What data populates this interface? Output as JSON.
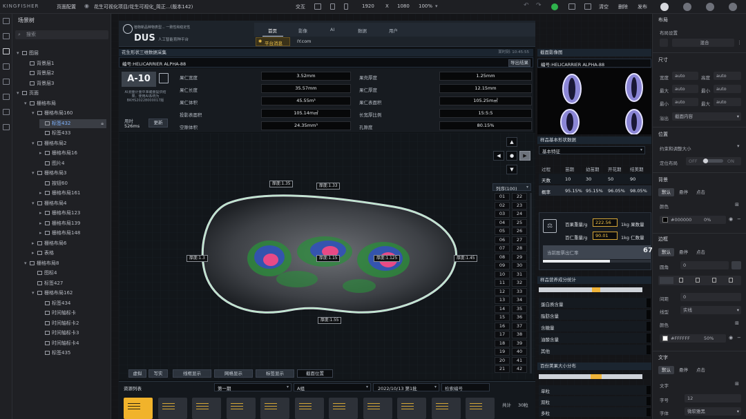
{
  "topbar": {
    "logo": "KINGFISHER",
    "menu": "页面配置",
    "breadcrumb": "花生可视化项目/花生可视化_简正...(版本142)",
    "interact": "交互",
    "width": "1920",
    "x": "X",
    "height": "1080",
    "zoom": "100%",
    "clear": "清空",
    "delete": "删除",
    "publish": "发布"
  },
  "tree": {
    "title": "场景树",
    "search_placeholder": "搜索",
    "nodes": [
      {
        "label": "图层",
        "level": 0,
        "arrow": "▾"
      },
      {
        "label": "背景层1",
        "level": 1,
        "arrow": ""
      },
      {
        "label": "背景层2",
        "level": 1,
        "arrow": ""
      },
      {
        "label": "背景层3",
        "level": 1,
        "arrow": ""
      },
      {
        "label": "页面",
        "level": 0,
        "arrow": "▾"
      },
      {
        "label": "栅格布局",
        "level": 1,
        "arrow": "▾"
      },
      {
        "label": "栅格布局160",
        "level": 2,
        "arrow": "▾"
      },
      {
        "label": "标签432",
        "level": 3,
        "arrow": "",
        "selected": true
      },
      {
        "label": "标签433",
        "level": 3,
        "arrow": ""
      },
      {
        "label": "栅格布局2",
        "level": 2,
        "arrow": "▾"
      },
      {
        "label": "栅格布局16",
        "level": 3,
        "arrow": "▸"
      },
      {
        "label": "图片4",
        "level": 3,
        "arrow": ""
      },
      {
        "label": "栅格布局3",
        "level": 2,
        "arrow": "▾"
      },
      {
        "label": "按钮60",
        "level": 3,
        "arrow": ""
      },
      {
        "label": "栅格布局161",
        "level": 3,
        "arrow": "▸"
      },
      {
        "label": "栅格布局4",
        "level": 2,
        "arrow": "▾"
      },
      {
        "label": "栅格布局123",
        "level": 3,
        "arrow": "▸"
      },
      {
        "label": "栅格布局139",
        "level": 3,
        "arrow": "▸"
      },
      {
        "label": "栅格布局148",
        "level": 3,
        "arrow": "▸"
      },
      {
        "label": "栅格布局6",
        "level": 2,
        "arrow": "▸"
      },
      {
        "label": "表格",
        "level": 2,
        "arrow": "▸"
      },
      {
        "label": "栅格布局8",
        "level": 1,
        "arrow": "▾"
      },
      {
        "label": "图标4",
        "level": 2,
        "arrow": ""
      },
      {
        "label": "标签427",
        "level": 2,
        "arrow": ""
      },
      {
        "label": "栅格布局162",
        "level": 2,
        "arrow": "▾"
      },
      {
        "label": "标签434",
        "level": 3,
        "arrow": ""
      },
      {
        "label": "时间轴标卡",
        "level": 3,
        "arrow": ""
      },
      {
        "label": "时间轴标卡2",
        "level": 3,
        "arrow": ""
      },
      {
        "label": "时间轴标卡3",
        "level": 3,
        "arrow": ""
      },
      {
        "label": "时间轴标卡4",
        "level": 3,
        "arrow": ""
      },
      {
        "label": "标签435",
        "level": 3,
        "arrow": ""
      }
    ]
  },
  "app": {
    "brand_line1": "植物新品种物表型... 一致性和稳定性",
    "brand_name": "DUS",
    "brand_line2": "人工智能育种平台",
    "nav": [
      "首页",
      "影像",
      "AI",
      "数据",
      "用户"
    ],
    "notice": "平台消息",
    "notice_text": "IY.com"
  },
  "sample": {
    "panel_title": "花生形状三维数据采集",
    "timestamp": "某时刻: 10:45:55",
    "id_label": "编号:HELICARRIER ALPHA-88",
    "export": "导出结果",
    "code": "A-10",
    "ai_note": "AI测量计量中准确量提供结果。使用AI系统为BKHS20228000017版",
    "time_label": "用时",
    "time_value": "526ms",
    "refresh": "更新",
    "metrics_left": [
      {
        "label": "果仁宽度",
        "value": "3.52mm"
      },
      {
        "label": "果仁长度",
        "value": "35.57mm"
      },
      {
        "label": "果仁体积",
        "value": "45.55m³"
      },
      {
        "label": "投影表面积",
        "value": "105.14m㎡"
      },
      {
        "label": "空隙体积",
        "value": "24.35mm³"
      }
    ],
    "metrics_right": [
      {
        "label": "果壳厚度",
        "value": "1.25mm"
      },
      {
        "label": "果仁厚度",
        "value": "12.15mm"
      },
      {
        "label": "果仁表面积",
        "value": "105.25m㎡"
      },
      {
        "label": "长宽厚比例",
        "value": "15:5:5"
      },
      {
        "label": "孔隙度",
        "value": "80.15%"
      }
    ]
  },
  "thickness": [
    {
      "label": "厚度:1.35"
    },
    {
      "label": "厚度:1.33"
    },
    {
      "label": "厚度:1.3"
    },
    {
      "label": "厚度:1.15"
    },
    {
      "label": "厚度:1.125"
    },
    {
      "label": "厚度:1.45"
    },
    {
      "label": "厚度:1.55"
    }
  ],
  "columns": {
    "header": "列序(100)",
    "left": [
      "01",
      "02",
      "03",
      "04",
      "05",
      "06",
      "07",
      "08",
      "09",
      "10",
      "11",
      "12",
      "13",
      "14",
      "15",
      "16",
      "17",
      "18",
      "19",
      "20",
      "21"
    ],
    "right": [
      "22",
      "23",
      "24",
      "25",
      "26",
      "27",
      "28",
      "29",
      "30",
      "31",
      "32",
      "33",
      "34",
      "35",
      "36",
      "37",
      "38",
      "39",
      "40",
      "41",
      "42"
    ]
  },
  "viewer_buttons": [
    "虚拟",
    "写实",
    "线框显示",
    "网格显示",
    "标签显示",
    "截面位置"
  ],
  "resources": {
    "title": "资源列表",
    "period": "第一期",
    "group": "A组",
    "date": "2022/10/13 第1批",
    "search": "检索编号",
    "total_label": "共计",
    "total": "30粒"
  },
  "xray": {
    "title": "截面影像图",
    "id": "编号:HELICARRIER ALPHA-88"
  },
  "features": {
    "title": "样品基本形状数据",
    "select": "基本特征",
    "table": {
      "headers": [
        "过程",
        "苗期",
        "幼苗期",
        "开花期",
        "结荚期"
      ],
      "rows": [
        [
          "天数",
          "10",
          "30",
          "50",
          "90"
        ],
        [
          "概率",
          "95.15%",
          "95.15%",
          "96.05%",
          "98.05%"
        ]
      ]
    },
    "yield1_label": "百果重量/g",
    "yield1_value": "222.56",
    "yield1_unit": "1kg 果数量",
    "yield2_label": "百仁重量/g",
    "yield2_value": "90.01",
    "yield2_unit": "1kg 仁数量",
    "rate_label": "当前股票出仁率",
    "rate_value": "67",
    "rate_pct": 0.62
  },
  "nutrition": {
    "title": "样品营养成分统计",
    "items": [
      "蛋白质含量",
      "脂肪含量",
      "含糖量",
      "油酸含量",
      "其他"
    ],
    "bar_pct": 0.55,
    "size_title": "百份荚果大小分布",
    "size_items": [
      "单粒",
      "双粒",
      "多粒"
    ],
    "size_pct": 0.55
  },
  "props": {
    "layout_section": "布局",
    "layout_settings": "布局设置",
    "mix": "混合",
    "size_section": "尺寸",
    "size_rows": [
      {
        "a": "宽度",
        "b": "高度"
      },
      {
        "a": "最大",
        "b": "最小"
      },
      {
        "a": "最小",
        "b": "最大"
      }
    ],
    "auto": "auto",
    "overflow_label": "溢出",
    "overflow_value": "截面内容",
    "position_section": "位置",
    "constraint": "约束和调整大小",
    "fixed_label": "定位布局",
    "off": "OFF",
    "on": "ON",
    "bg_section": "背景",
    "tabs": [
      "默认",
      "悬停",
      "点击"
    ],
    "color_label": "颜色",
    "bg_color": "#000000",
    "bg_opacity": "0%",
    "border_section": "边框",
    "radius_label": "圆角",
    "radius_value": "0",
    "spacing_label": "间距",
    "spacing_value": "0",
    "line_label": "线型",
    "line_value": "实线",
    "border_color": "#FFFFFF",
    "border_opacity": "50%",
    "text_section": "文字",
    "text_label": "文字",
    "font_size_label": "字号",
    "font_size_value": "12",
    "font_label": "字体",
    "font_value": "微软雅黑"
  }
}
